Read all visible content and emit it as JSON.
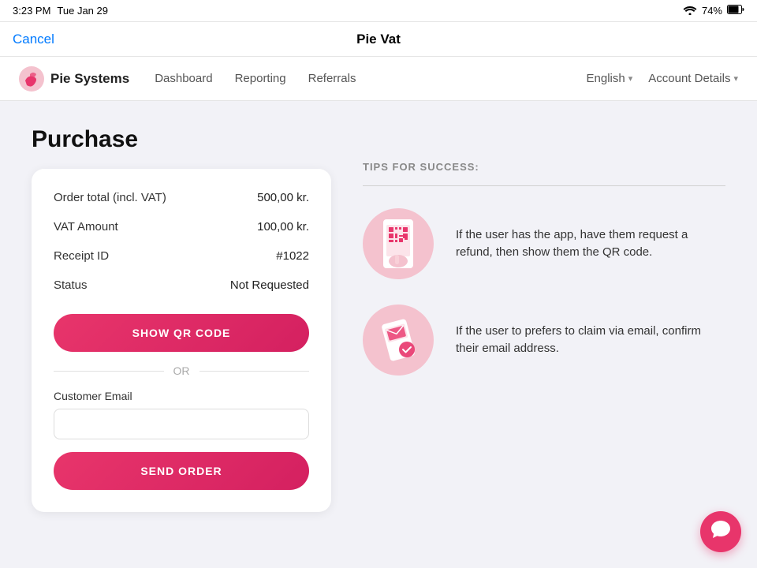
{
  "statusBar": {
    "time": "3:23 PM",
    "date": "Tue Jan 29",
    "wifi": "wifi",
    "battery": "74%"
  },
  "titleBar": {
    "cancelLabel": "Cancel",
    "title": "Pie Vat"
  },
  "navbar": {
    "brandName": "Pie Systems",
    "links": [
      {
        "label": "Dashboard"
      },
      {
        "label": "Reporting"
      },
      {
        "label": "Referrals"
      }
    ],
    "right": [
      {
        "label": "English",
        "hasDropdown": true
      },
      {
        "label": "Account Details",
        "hasDropdown": true
      }
    ]
  },
  "page": {
    "title": "Purchase"
  },
  "purchaseCard": {
    "rows": [
      {
        "label": "Order total (incl. VAT)",
        "value": "500,00 kr."
      },
      {
        "label": "VAT Amount",
        "value": "100,00 kr."
      },
      {
        "label": "Receipt ID",
        "value": "#1022"
      },
      {
        "label": "Status",
        "value": "Not Requested"
      }
    ],
    "showQrLabel": "SHOW QR CODE",
    "orLabel": "OR",
    "emailLabel": "Customer Email",
    "emailPlaceholder": "",
    "sendOrderLabel": "SEND ORDER"
  },
  "tips": {
    "title": "TIPS FOR SUCCESS:",
    "items": [
      {
        "text": "If the user has the app, have them request a refund, then show them the QR code."
      },
      {
        "text": "If the user to prefers to claim via email, confirm their email address."
      }
    ]
  },
  "chatBubble": {
    "icon": "💬"
  }
}
